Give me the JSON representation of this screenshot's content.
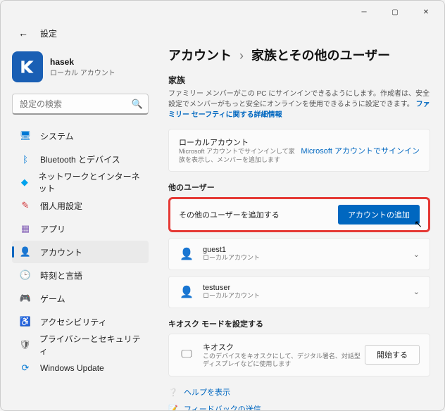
{
  "window": {
    "title": "設定"
  },
  "profile": {
    "name": "hasek",
    "sub": "ローカル アカウント"
  },
  "search": {
    "placeholder": "設定の検索"
  },
  "nav": [
    {
      "label": "システム",
      "iconClass": "i-system",
      "glyph": "🖥"
    },
    {
      "label": "Bluetooth とデバイス",
      "iconClass": "i-bt",
      "glyph": "ᛒ"
    },
    {
      "label": "ネットワークとインターネット",
      "iconClass": "i-net",
      "glyph": "◆"
    },
    {
      "label": "個人用設定",
      "iconClass": "i-pers",
      "glyph": "✎"
    },
    {
      "label": "アプリ",
      "iconClass": "i-apps",
      "glyph": "▦"
    },
    {
      "label": "アカウント",
      "iconClass": "i-acc",
      "glyph": "👤",
      "selected": true
    },
    {
      "label": "時刻と言語",
      "iconClass": "i-time",
      "glyph": "🕒"
    },
    {
      "label": "ゲーム",
      "iconClass": "i-game",
      "glyph": "🎮"
    },
    {
      "label": "アクセシビリティ",
      "iconClass": "i-access",
      "glyph": "♿"
    },
    {
      "label": "プライバシーとセキュリティ",
      "iconClass": "i-priv",
      "glyph": "🛡"
    },
    {
      "label": "Windows Update",
      "iconClass": "i-update",
      "glyph": "⟳"
    }
  ],
  "breadcrumb": {
    "p1": "アカウント",
    "p2": "家族とその他のユーザー"
  },
  "family": {
    "label": "家族",
    "desc": "ファミリー メンバーがこの PC にサインインできるようにします。作成者は、安全設定でメンバーがもっと安全にオンラインを使用できるように設定できます。 ",
    "link": "ファミリー セーフティに関する詳細情報",
    "cardTitle": "ローカルアカウント",
    "cardSub": "Microsoft アカウントでサインインして家族を表示し、メンバーを追加します",
    "action": "Microsoft アカウントでサインイン"
  },
  "other": {
    "label": "他のユーザー",
    "addTitle": "その他のユーザーを追加する",
    "addBtn": "アカウントの追加",
    "users": [
      {
        "name": "guest1",
        "sub": "ローカルアカウント"
      },
      {
        "name": "testuser",
        "sub": "ローカルアカウント"
      }
    ]
  },
  "kiosk": {
    "label": "キオスク モードを設定する",
    "title": "キオスク",
    "sub": "このデバイスをキオスクにして、デジタル署名、対話型ディスプレイなどに使用します",
    "btn": "開始する"
  },
  "footer": {
    "help": "ヘルプを表示",
    "feedback": "フィードバックの送信"
  }
}
